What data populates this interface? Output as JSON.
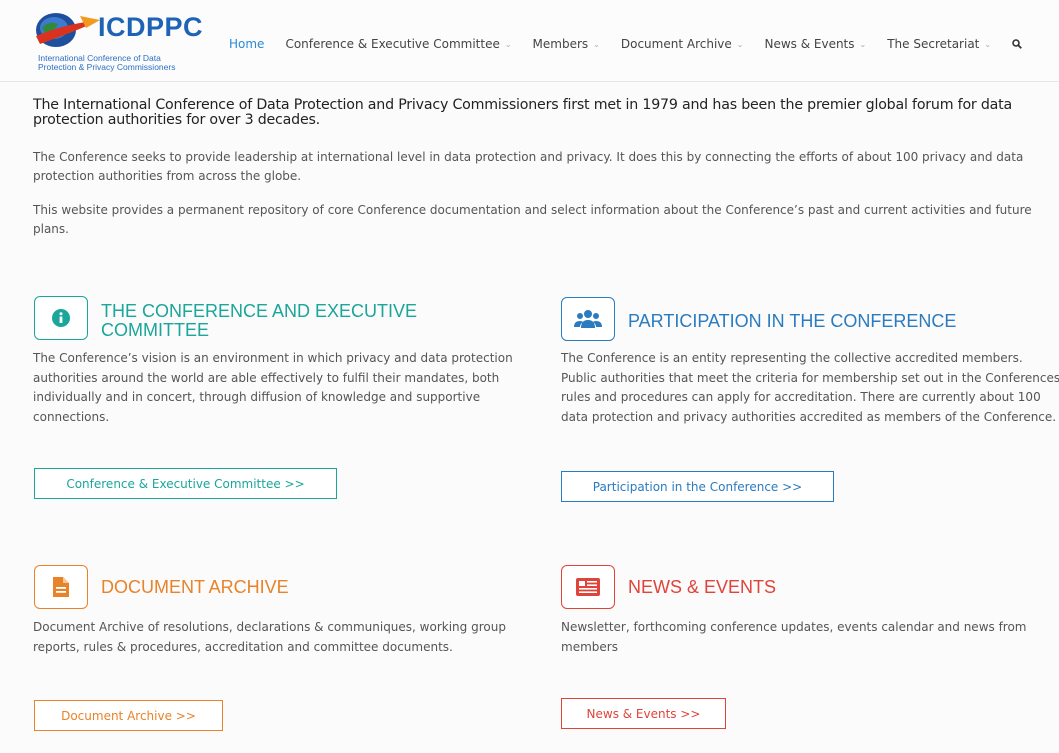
{
  "brand": {
    "name": "ICDPPC",
    "subtitle_line1": "International Conference of Data",
    "subtitle_line2": "Protection & Privacy Commissioners"
  },
  "nav": {
    "items": [
      {
        "label": "Home",
        "active": true,
        "dropdown": false
      },
      {
        "label": "Conference & Executive Committee",
        "dropdown": true
      },
      {
        "label": "Members",
        "dropdown": true
      },
      {
        "label": "Document Archive",
        "dropdown": true
      },
      {
        "label": "News & Events",
        "dropdown": true
      },
      {
        "label": "The Secretariat",
        "dropdown": true
      }
    ],
    "search_icon": "search-icon"
  },
  "intro": {
    "heading": "The International Conference of Data Protection and Privacy Commissioners first met in 1979 and has been the premier global forum for data protection authorities for over 3 decades.",
    "p1": "The Conference seeks to provide leadership at international level in data protection and privacy. It does this by connecting the efforts of about 100 privacy and data protection authorities from across the globe.",
    "p2": "This website provides a permanent repository of core Conference documentation and select information about the Conference’s past and current activities and future plans."
  },
  "sections": [
    {
      "icon": "info-circle-icon",
      "title_line1": "THE CONFERENCE AND EXECUTIVE",
      "title_line2": "COMMITTEE",
      "text": "The Conference’s vision is an environment in which privacy and data protection authorities around the world are able effectively to fulfil their mandates, both individually and in concert, through diffusion of knowledge and supportive connections.",
      "button": "Conference & Executive Committee >>",
      "color": "#1aa69a"
    },
    {
      "icon": "users-group-icon",
      "title_line1": "PARTICIPATION IN THE CONFERENCE",
      "text": "The Conference is an entity representing the collective accredited members. Public authorities that meet the criteria for membership set out in the Conferences rules and procedures can apply for accreditation. There are currently about 100 data protection and privacy authorities accredited as members of the Conference.",
      "button": "Participation in the Conference >>",
      "color": "#2a7bbf"
    },
    {
      "icon": "document-icon",
      "title_line1": "DOCUMENT ARCHIVE",
      "text": "Document Archive of resolutions, declarations & communiques, working group reports, rules & procedures, accreditation and committee documents.",
      "button": "Document Archive >>",
      "color": "#e8832a"
    },
    {
      "icon": "newspaper-icon",
      "title_line1": "NEWS & EVENTS",
      "text": "Newsletter, forthcoming conference updates, events calendar and news from members",
      "button": "News & Events >>",
      "color": "#e0433a"
    }
  ]
}
